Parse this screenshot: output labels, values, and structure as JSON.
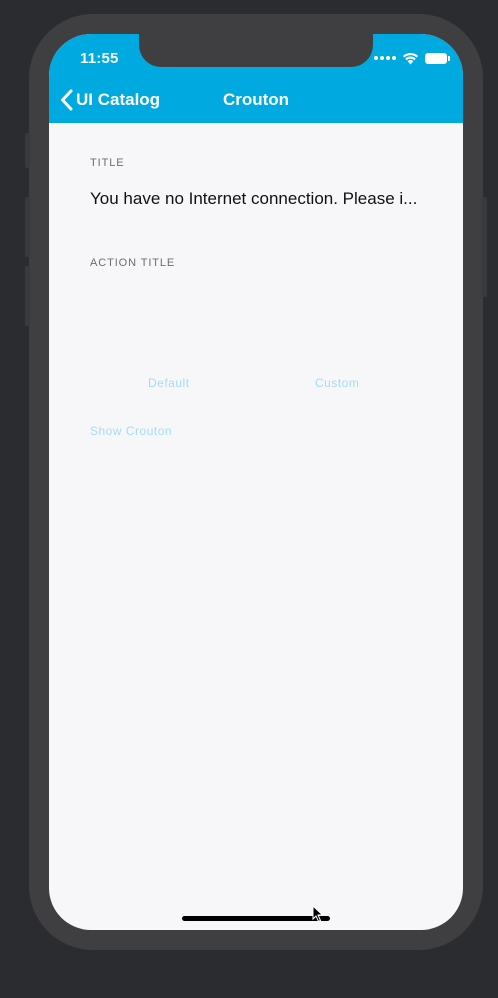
{
  "status_bar": {
    "time": "11:55",
    "icons": [
      "signal-dots-icon",
      "wifi-icon",
      "battery-icon"
    ]
  },
  "nav": {
    "back_label": "UI Catalog",
    "title": "Crouton"
  },
  "fields": {
    "title_label": "TITLE",
    "title_value": "You have no Internet connection. Please i...",
    "action_title_label": "ACTION TITLE"
  },
  "actions": {
    "default_label": "Default",
    "custom_label": "Custom",
    "show_crouton_label": "Show Crouton"
  },
  "colors": {
    "accent": "#00a9e0",
    "background": "#f7f7f9",
    "device": "#3f3f41"
  }
}
